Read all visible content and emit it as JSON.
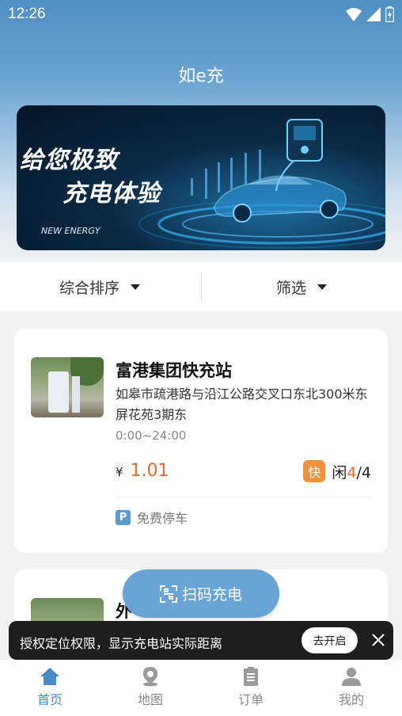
{
  "status": {
    "time": "12:26"
  },
  "app_title": "如e充",
  "banner": {
    "line1": "给您极致",
    "line2": "充电体验",
    "tag": "NEW ENERGY"
  },
  "filters": {
    "sort_label": "综合排序",
    "filter_label": "筛选"
  },
  "stations": [
    {
      "name": "富港集团快充站",
      "address": "如皋市疏港路与沿江公路交叉口东北300米东屏花苑3期东",
      "hours": "0:00~24:00",
      "currency": "¥",
      "price": "1.01",
      "fast_label": "快",
      "free_label": "闲",
      "free_count": "4",
      "total_count": "/4",
      "parking_icon": "P",
      "parking_label": "免费停车"
    },
    {
      "name": "外"
    }
  ],
  "scan_button": {
    "label": "扫码充电",
    "icon": "scan-icon"
  },
  "toast": {
    "message": "授权定位权限，显示充电站实际距离",
    "action": "去开启"
  },
  "tabs": [
    {
      "label": "首页",
      "icon": "home-icon",
      "active": true
    },
    {
      "label": "地图",
      "icon": "map-pin-icon",
      "active": false
    },
    {
      "label": "订单",
      "icon": "order-icon",
      "active": false
    },
    {
      "label": "我的",
      "icon": "user-icon",
      "active": false
    }
  ],
  "colors": {
    "primary": "#4a8ac8",
    "accent": "#e66a2c",
    "fast_badge": "#f0923a",
    "parking": "#5b9bd0"
  }
}
